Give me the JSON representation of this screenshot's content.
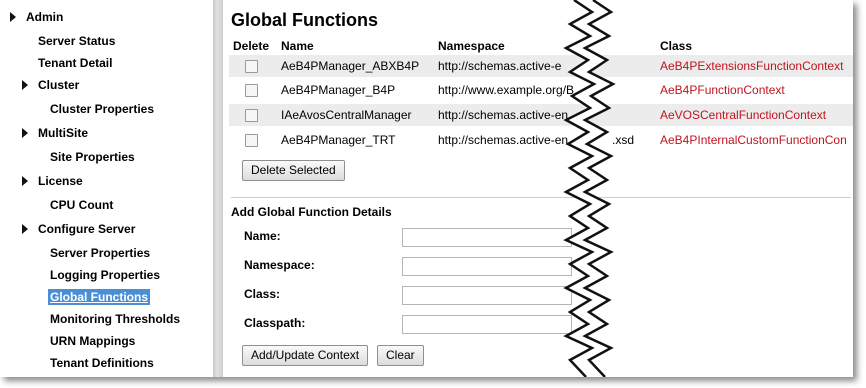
{
  "nav": {
    "items": [
      {
        "label": "Admin"
      },
      {
        "label": "Server Status"
      },
      {
        "label": "Tenant Detail"
      },
      {
        "label": "Cluster"
      },
      {
        "label": "Cluster Properties"
      },
      {
        "label": "MultiSite"
      },
      {
        "label": "Site Properties"
      },
      {
        "label": "License"
      },
      {
        "label": "CPU Count"
      },
      {
        "label": "Configure Server"
      },
      {
        "label": "Server Properties"
      },
      {
        "label": "Logging Properties"
      },
      {
        "label": "Global Functions"
      },
      {
        "label": "Monitoring Thresholds"
      },
      {
        "label": "URN Mappings"
      },
      {
        "label": "Tenant Definitions"
      }
    ],
    "selected": "Global Functions"
  },
  "main": {
    "title": "Global Functions",
    "table": {
      "headers": [
        "Delete",
        "Name",
        "Namespace",
        "Class"
      ],
      "rows": [
        {
          "name": "AeB4PManager_ABXB4P",
          "namespace": "http://schemas.active-e",
          "class": "AeB4PExtensionsFunctionContext"
        },
        {
          "name": "AeB4PManager_B4P",
          "namespace": "http://www.example.org/B",
          "class": "AeB4PFunctionContext"
        },
        {
          "name": "IAeAvosCentralManager",
          "namespace": "http://schemas.active-en",
          "class": "AeVOSCentralFunctionContext"
        },
        {
          "name": "AeB4PManager_TRT",
          "namespace": "http://schemas.active-en",
          "namespace_tail": ".xsd",
          "class": "AeB4PInternalCustomFunctionCon"
        }
      ]
    },
    "delete_button": "Delete Selected",
    "details": {
      "title": "Add Global Function Details",
      "fields": [
        {
          "label": "Name:",
          "value": ""
        },
        {
          "label": "Namespace:",
          "value": ""
        },
        {
          "label": "Class:",
          "value": ""
        },
        {
          "label": "Classpath:",
          "value": ""
        }
      ]
    },
    "add_button": "Add/Update Context",
    "clear_button": "Clear"
  },
  "colors": {
    "class_text": "#c0141f",
    "selected_nav_bg": "#4a8fd6",
    "row_shade": "#ececec"
  }
}
